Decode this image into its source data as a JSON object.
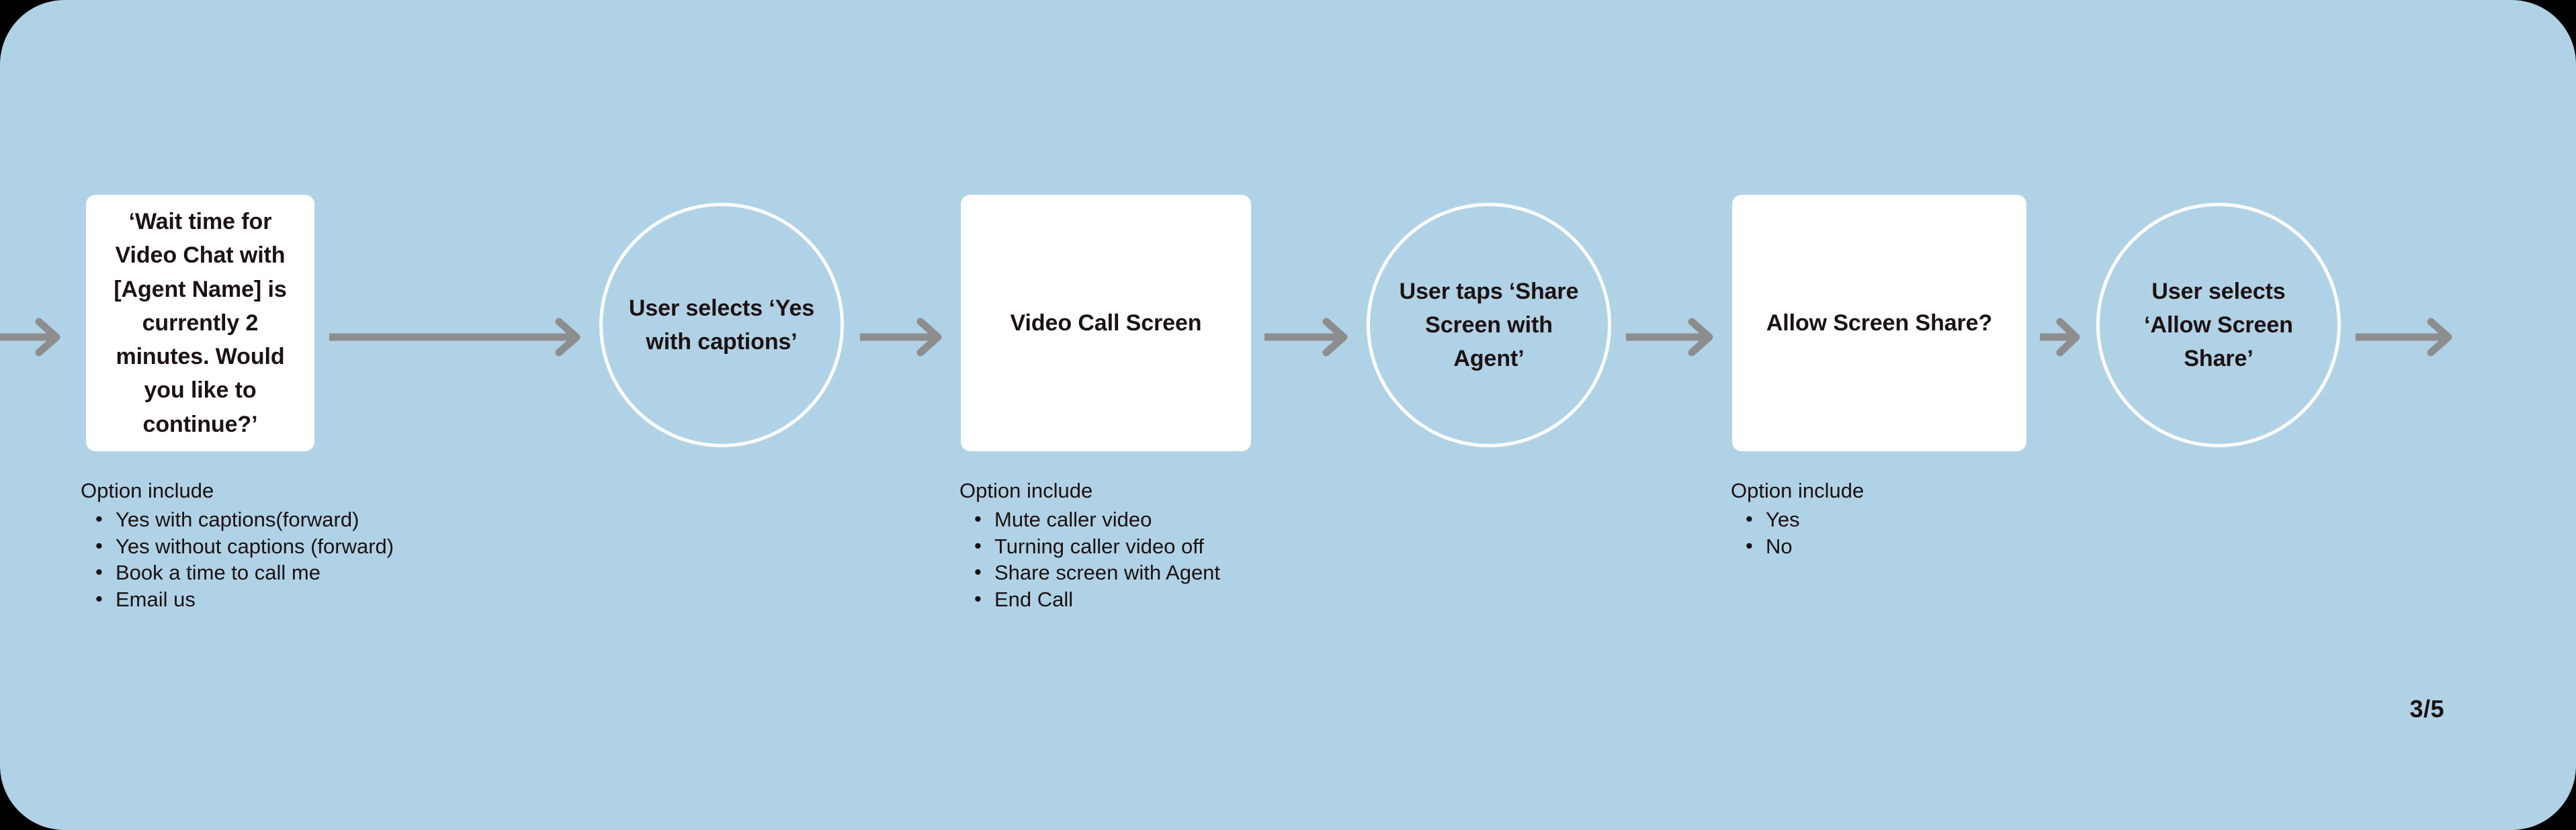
{
  "canvas": {
    "background_color": "#b0d2e6",
    "page_background_color": "#000000"
  },
  "colors": {
    "background": "#b0d2e6",
    "node_fill": "#ffffff",
    "circle_stroke": "#ffffff",
    "arrow": "#8d8d8d",
    "text": "#1b1111"
  },
  "diagram": {
    "type": "horizontal-flow",
    "nodes": [
      {
        "id": "wait-time",
        "shape": "rounded-rect",
        "label": "‘Wait time for Video Chat with [Agent Name] is currently 2 minutes. Would you like to continue?’"
      },
      {
        "id": "yes-captions",
        "shape": "circle",
        "label": "User selects ‘Yes with captions’"
      },
      {
        "id": "video-call",
        "shape": "rounded-rect",
        "label": "Video Call Screen"
      },
      {
        "id": "share-screen-tap",
        "shape": "circle",
        "label": "User taps ‘Share Screen with Agent’"
      },
      {
        "id": "allow-share",
        "shape": "rounded-rect",
        "label": "Allow Screen Share?"
      },
      {
        "id": "allow-share-tap",
        "shape": "circle",
        "label": "User selects ‘Allow Screen Share’"
      }
    ],
    "option_groups": [
      {
        "id": "wait-time-options",
        "title": "Option include",
        "items": [
          "Yes with captions(forward)",
          "Yes without captions (forward)",
          "Book a time to call me",
          "Email us"
        ]
      },
      {
        "id": "video-call-options",
        "title": "Option include",
        "items": [
          "Mute caller video",
          "Turning caller video off",
          "Share screen with Agent",
          "End Call"
        ]
      },
      {
        "id": "allow-share-options",
        "title": "Option include",
        "items": [
          "Yes",
          "No"
        ]
      }
    ],
    "arrows": [
      {
        "id": "arrow-in"
      },
      {
        "id": "arrow-wait-to-captions"
      },
      {
        "id": "arrow-captions-to-video"
      },
      {
        "id": "arrow-video-to-sharetap"
      },
      {
        "id": "arrow-sharetap-to-allow"
      },
      {
        "id": "arrow-allow-to-allowtap"
      },
      {
        "id": "arrow-out"
      }
    ]
  },
  "footer": {
    "page_indicator": "3/5"
  }
}
